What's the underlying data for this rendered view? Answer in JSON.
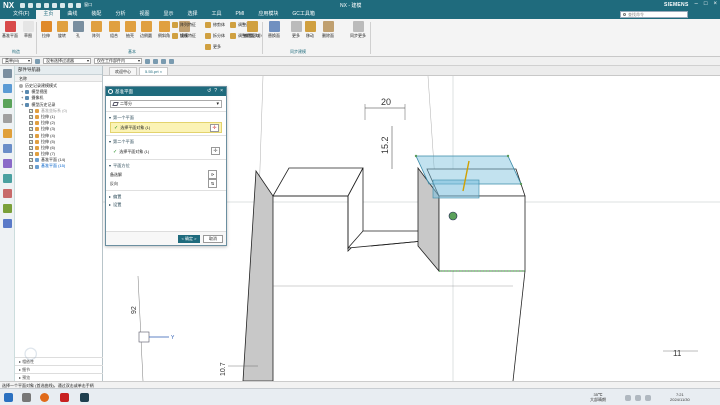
{
  "titlebar": {
    "logo": "NX",
    "title": "NX - 建模",
    "brand": "SIEMENS",
    "window_menu": "窗口"
  },
  "menu": {
    "tabs": [
      "文件(F)",
      "主页",
      "曲线",
      "装配",
      "分析",
      "视图",
      "显示",
      "选择",
      "工具",
      "PMI",
      "应用模块",
      "GC工具箱"
    ],
    "active": 1,
    "search_placeholder": "查找命令"
  },
  "ribbon": {
    "buttons": [
      "基准平面",
      "草图",
      "拉伸",
      "旋转",
      "孔",
      "阵列",
      "组合",
      "抽壳",
      "边倒圆",
      "倒斜角",
      "拔模",
      "偏置区域",
      "替换面",
      "更多",
      "移动",
      "删除面",
      "同步更多"
    ],
    "small": [
      "阵列特征",
      "镜像特征",
      "修剪体",
      "拆分体",
      "更多",
      "调整面",
      "调整倒圆大小"
    ],
    "groups": [
      "构造",
      "基本",
      "同步建模"
    ]
  },
  "selbar": {
    "filter": "菜单(M)",
    "type_filter": "没有选择过滤器",
    "scope": "仅在工作部件内"
  },
  "navigator": {
    "title": "部件导航器",
    "col_header": "名称",
    "items": [
      {
        "label": "历史记录建模模式",
        "type": "mode"
      },
      {
        "label": "模型视图",
        "type": "folder"
      },
      {
        "label": "摄像机",
        "type": "folder"
      },
      {
        "label": "模型历史记录",
        "type": "folder"
      },
      {
        "label": "基准坐标系 (0)",
        "type": "feature"
      },
      {
        "label": "拉伸 (1)",
        "type": "feature"
      },
      {
        "label": "拉伸 (2)",
        "type": "feature"
      },
      {
        "label": "拉伸 (3)",
        "type": "feature"
      },
      {
        "label": "拉伸 (4)",
        "type": "feature"
      },
      {
        "label": "拉伸 (5)",
        "type": "feature"
      },
      {
        "label": "拉伸 (6)",
        "type": "feature"
      },
      {
        "label": "拉伸 (7)",
        "type": "feature"
      },
      {
        "label": "基准平面 (14)",
        "type": "feature"
      },
      {
        "label": "基准平面 (15)",
        "type": "feature"
      }
    ],
    "footer": [
      "相依性",
      "细节",
      "预览"
    ]
  },
  "doctabs": [
    "欢迎中心",
    "5.55.prt"
  ],
  "dialog": {
    "title": "基准平面",
    "type_value": "二等分",
    "section1": "第一个平面",
    "sel1": "选择平面对象 (1)",
    "section2": "第二个平面",
    "sel2": "选择平面对象 (1)",
    "section3": "平面方位",
    "alt_solution": "备选解",
    "reverse": "反向",
    "section4": "偏置",
    "section5": "设置",
    "ok": "< 确定 >",
    "cancel": "取消"
  },
  "viewport": {
    "dim_20": "20",
    "dim_152": "15.2",
    "dim_92": "92",
    "dim_107": "10.7",
    "dim_11": "11",
    "axis_y": "Y"
  },
  "statusbar": "选择一个平面对象 (首选曲线)，通过双击或单击手柄",
  "taskbar": {
    "weather_temp": "35℃",
    "weather_desc": "大部晴朗",
    "time": "7:21",
    "date": "2024/11/30"
  }
}
